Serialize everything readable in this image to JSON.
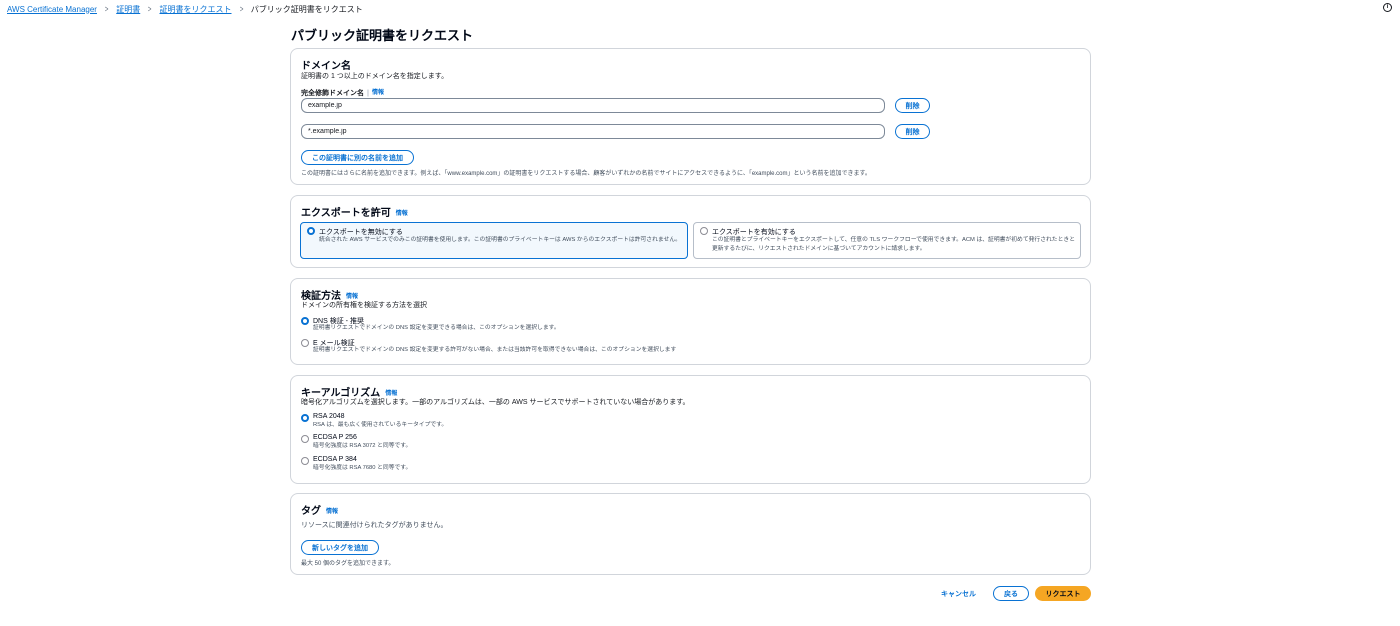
{
  "breadcrumb": {
    "items": [
      "AWS Certificate Manager",
      "証明書",
      "証明書をリクエスト"
    ],
    "current": "パブリック証明書をリクエスト"
  },
  "help_icon": "info-circle-icon",
  "page_title": "パブリック証明書をリクエスト",
  "info_label": "情報",
  "domain": {
    "title": "ドメイン名",
    "description": "証明書の 1 つ以上のドメイン名を指定します。",
    "field_label": "完全修飾ドメイン名",
    "entries": [
      {
        "value": "example.jp",
        "remove_label": "削除"
      },
      {
        "value": "*.example.jp",
        "remove_label": "削除"
      }
    ],
    "add_button": "この証明書に別の名前を追加",
    "hint": "この証明書にはさらに名前を追加できます。例えば、「www.example.com」の証明書をリクエストする場合、顧客がいずれかの名前でサイトにアクセスできるように、「example.com」という名前を追加できます。"
  },
  "export": {
    "title": "エクスポートを許可",
    "options": [
      {
        "label": "エクスポートを無効にする",
        "description": "統合された AWS サービスでのみこの証明書を使用します。この証明書のプライベートキーは AWS からのエクスポートは許可されません。",
        "selected": true
      },
      {
        "label": "エクスポートを有効にする",
        "description": "この証明書とプライベートキーをエクスポートして、任意の TLS ワークフローで使用できます。ACM は、証明書が初めて発行されたときと更新するたびに、リクエストされたドメインに基づいてアカウントに請求します。",
        "selected": false
      }
    ]
  },
  "validation": {
    "title": "検証方法",
    "description": "ドメインの所有権を検証する方法を選択",
    "options": [
      {
        "label": "DNS 検証 - 推奨",
        "description": "証明書リクエストでドメインの DNS 設定を変更できる場合は、このオプションを選択します。",
        "selected": true
      },
      {
        "label": "E メール検証",
        "description": "証明書リクエストでドメインの DNS 設定を変更する許可がない場合、または当該許可を取得できない場合は、このオプションを選択します",
        "selected": false
      }
    ]
  },
  "key_algorithm": {
    "title": "キーアルゴリズム",
    "description": "暗号化アルゴリズムを選択します。一部のアルゴリズムは、一部の AWS サービスでサポートされていない場合があります。",
    "options": [
      {
        "label": "RSA 2048",
        "description": "RSA は、最も広く使用されているキータイプです。",
        "selected": true
      },
      {
        "label": "ECDSA P 256",
        "description": "暗号化強度は RSA 3072 と同等です。",
        "selected": false
      },
      {
        "label": "ECDSA P 384",
        "description": "暗号化強度は RSA 7680 と同等です。",
        "selected": false
      }
    ]
  },
  "tags": {
    "title": "タグ",
    "description": "リソースに関連付けられたタグがありません。",
    "add_button": "新しいタグを追加",
    "hint": "最大 50 個のタグを追加できます。"
  },
  "footer": {
    "cancel": "キャンセル",
    "back": "戻る",
    "submit": "リクエスト"
  },
  "colors": {
    "accent": "#0972d3",
    "primary_button": "#f5a623"
  }
}
